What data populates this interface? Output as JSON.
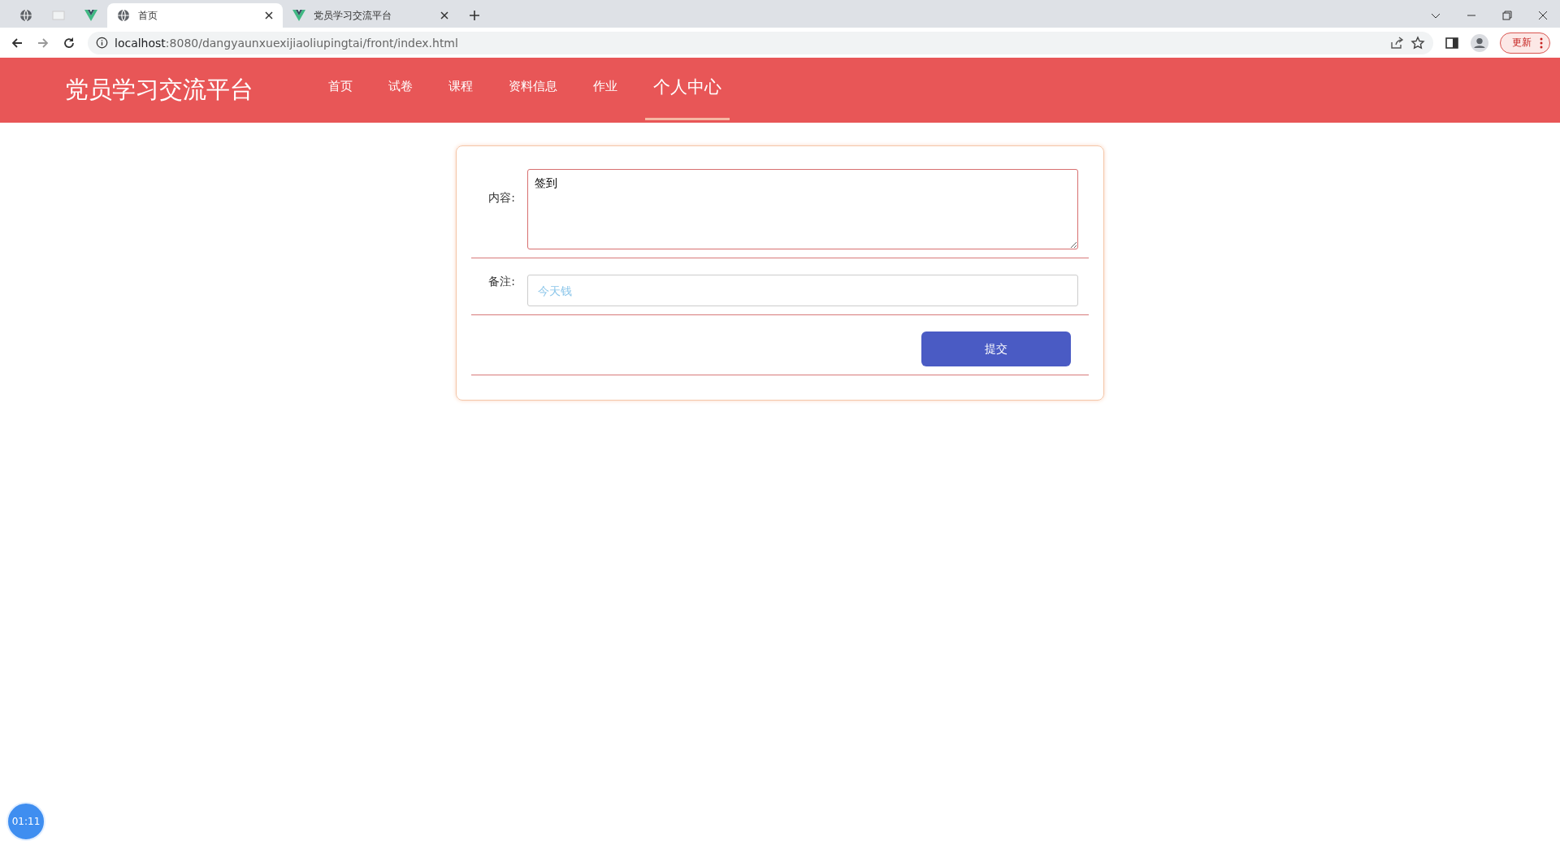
{
  "browser": {
    "tabs": [
      {
        "kind": "globe",
        "selected": false
      },
      {
        "kind": "blank",
        "selected": false
      },
      {
        "kind": "vue",
        "selected": false
      },
      {
        "kind": "globe",
        "title": "首页",
        "selected": true
      },
      {
        "kind": "vue",
        "title": "党员学习交流平台",
        "selected": false
      }
    ],
    "url_host": "localhost",
    "url_rest": ":8080/dangyaunxuexijiaoliupingtai/front/index.html",
    "update_button": "更新"
  },
  "header": {
    "logo": "党员学习交流平台",
    "nav": [
      {
        "label": "首页",
        "selected": false
      },
      {
        "label": "试卷",
        "selected": false
      },
      {
        "label": "课程",
        "selected": false
      },
      {
        "label": "资料信息",
        "selected": false
      },
      {
        "label": "作业",
        "selected": false
      },
      {
        "label": "个人中心",
        "selected": true
      }
    ]
  },
  "form": {
    "content_label": "内容:",
    "content_value": "签到",
    "remark_label": "备注:",
    "remark_placeholder": "今天钱",
    "submit": "提交"
  },
  "timer": "01:11"
}
